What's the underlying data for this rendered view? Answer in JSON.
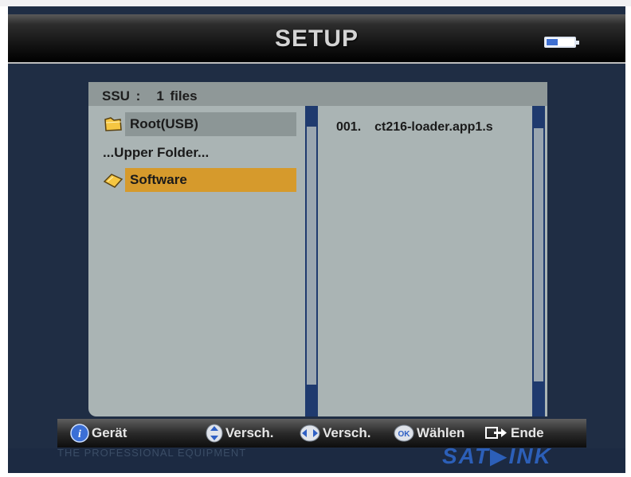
{
  "header": {
    "title": "SETUP"
  },
  "status": {
    "battery_icon": "battery-icon"
  },
  "browser": {
    "source": "SSU :",
    "file_count": "1 files",
    "folders": [
      {
        "label": "Root(USB)",
        "icon": "folder-icon"
      },
      {
        "label": "...Upper Folder..."
      },
      {
        "label": "Software",
        "icon": "folder-open-icon",
        "selected": true
      }
    ],
    "files": [
      {
        "index": "001.",
        "name": "ct216-loader.app1.s"
      }
    ]
  },
  "footer": {
    "hints": [
      {
        "icon": "info-icon",
        "label": "Gerät"
      },
      {
        "icon": "up-down-arrows-icon",
        "label": "Versch."
      },
      {
        "icon": "left-right-arrows-icon",
        "label": "Versch."
      },
      {
        "icon": "ok-icon",
        "label": "Wählen"
      },
      {
        "icon": "exit-icon",
        "label": "Ende"
      }
    ]
  },
  "colors": {
    "selected": "#d69a2c",
    "background": "#1f2d44",
    "panel": "#aab4b4",
    "scrollbar": "#1f3a6e"
  }
}
